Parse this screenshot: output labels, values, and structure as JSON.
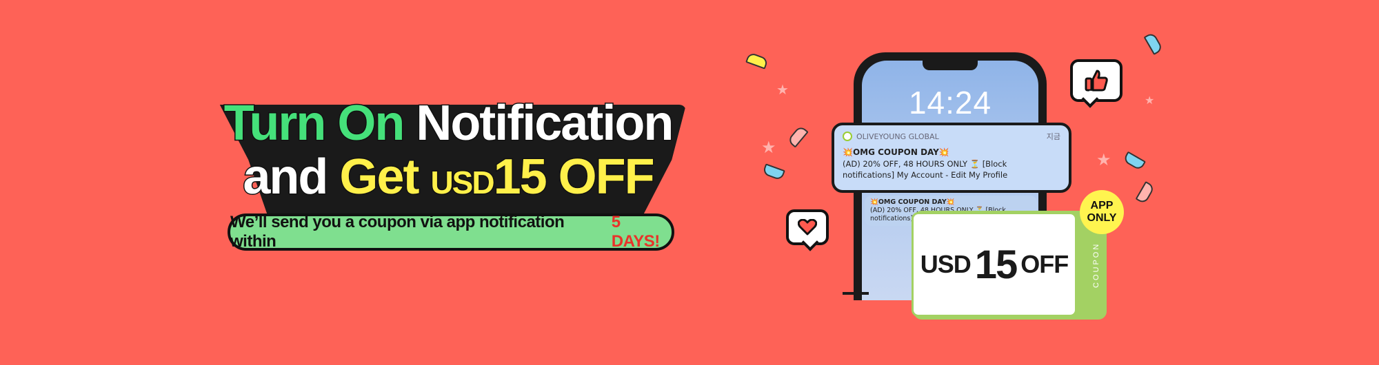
{
  "headline": {
    "line1_green": "Turn On",
    "line1_white": "Notification",
    "line2_white": "and",
    "line2_yellow": "Get",
    "line2_currency": "USD",
    "line2_amount": "15 OFF"
  },
  "subtitle": {
    "text": "We’ll send you a coupon via app notification within",
    "highlight": "5 DAYS!"
  },
  "phone": {
    "time": "14:24"
  },
  "notification": {
    "app_name": "OLIVEYOUNG GLOBAL",
    "time_label": "지금",
    "title": "💥OMG COUPON DAY💥",
    "body": "(AD) 20% OFF, 48 HOURS ONLY ⏳ [Block notifications] My Account - Edit My Profile"
  },
  "notification_secondary": {
    "title": "💥OMG COUPON DAY💥",
    "body": "(AD) 20% OFF, 48 HOURS ONLY ⏳ [Block notifications] M..."
  },
  "coupon": {
    "currency": "USD",
    "amount": "15",
    "off": "OFF",
    "stub_label": "COUPON",
    "badge_line1": "APP",
    "badge_line2": "ONLY"
  },
  "colors": {
    "background": "#fe6257",
    "green": "#45e07a",
    "yellow": "#fff04a",
    "pill_green": "#7fdf8f",
    "coupon_green": "#a3d163",
    "highlight_red": "#e8332a"
  },
  "icons": [
    "thumbs-up-icon",
    "heart-icon",
    "confetti-icon",
    "star-icon"
  ]
}
